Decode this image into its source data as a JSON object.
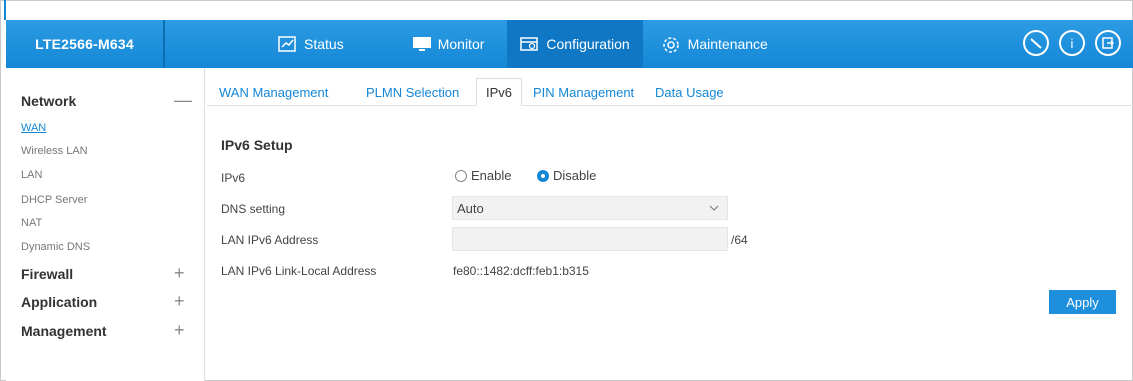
{
  "header": {
    "brand": "LTE2566-M634",
    "nav": [
      {
        "label": "Status",
        "icon": "status-icon",
        "active": false
      },
      {
        "label": "Monitor",
        "icon": "monitor-icon",
        "active": false
      },
      {
        "label": "Configuration",
        "icon": "configuration-icon",
        "active": true
      },
      {
        "label": "Maintenance",
        "icon": "gear-icon",
        "active": false
      }
    ],
    "tools": [
      "wizard-icon",
      "info-icon",
      "logout-icon"
    ]
  },
  "sidebar": {
    "groups": [
      {
        "label": "Network",
        "toggle": "—",
        "items": [
          "WAN",
          "Wireless LAN",
          "LAN",
          "DHCP Server",
          "NAT",
          "Dynamic DNS"
        ]
      },
      {
        "label": "Firewall",
        "toggle": "+"
      },
      {
        "label": "Application",
        "toggle": "+"
      },
      {
        "label": "Management",
        "toggle": "+"
      }
    ],
    "active_item": "WAN"
  },
  "tabs": [
    "WAN Management",
    "PLMN Selection",
    "IPv6",
    "PIN Management",
    "Data Usage"
  ],
  "active_tab": "IPv6",
  "form": {
    "title": "IPv6 Setup",
    "ipv6_label": "IPv6",
    "enable_label": "Enable",
    "disable_label": "Disable",
    "ipv6_value": "Disable",
    "dns_label": "DNS setting",
    "dns_value": "Auto",
    "lan_addr_label": "LAN IPv6 Address",
    "lan_addr_value": "",
    "lan_addr_suffix": "/64",
    "link_local_label": "LAN IPv6 Link-Local Address",
    "link_local_value": "fe80::1482:dcff:feb1:b315",
    "apply_label": "Apply"
  },
  "colors": {
    "accent": "#1487d6",
    "header_active": "#0f77c4",
    "button": "#1e8fdc"
  }
}
